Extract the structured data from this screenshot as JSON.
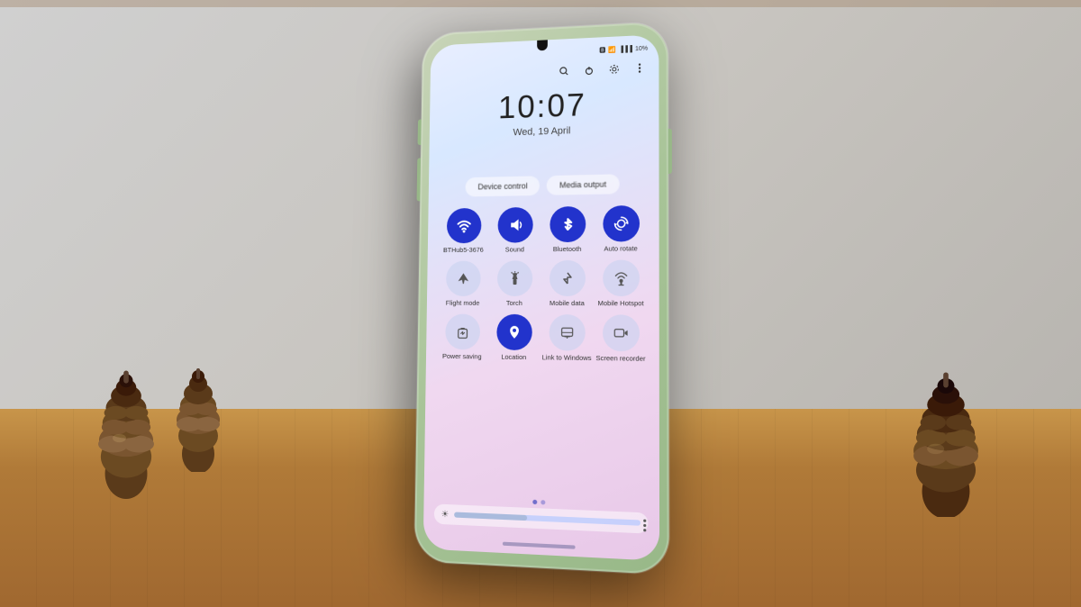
{
  "room": {
    "wall_color": "#c8c5c0",
    "table_color": "#c8954a"
  },
  "phone": {
    "frame_color": "#a8c498",
    "time": "10:07",
    "date": "Wed, 19 April",
    "status": {
      "battery": "10%",
      "signal": "4G"
    },
    "buttons": {
      "device_control": "Device control",
      "media_output": "Media output"
    },
    "quick_settings": {
      "row1": [
        {
          "id": "wifi",
          "label": "BTHub5-3676",
          "active": true,
          "icon": "📶"
        },
        {
          "id": "sound",
          "label": "Sound",
          "active": true,
          "icon": "🔊"
        },
        {
          "id": "bluetooth",
          "label": "Bluetooth",
          "active": true,
          "icon": "🔵"
        },
        {
          "id": "autorotate",
          "label": "Auto rotate",
          "active": true,
          "icon": "🔄"
        }
      ],
      "row2": [
        {
          "id": "flightmode",
          "label": "Flight mode",
          "active": false,
          "icon": "✈"
        },
        {
          "id": "torch",
          "label": "Torch",
          "active": false,
          "icon": "🔦"
        },
        {
          "id": "mobiledata",
          "label": "Mobile data",
          "active": false,
          "icon": "📡"
        },
        {
          "id": "mobilehotspot",
          "label": "Mobile Hotspot",
          "active": false,
          "icon": "📲"
        }
      ],
      "row3": [
        {
          "id": "powersaving",
          "label": "Power saving",
          "active": false,
          "icon": "🔋"
        },
        {
          "id": "location",
          "label": "Location",
          "active": true,
          "icon": "📍"
        },
        {
          "id": "linktowindows",
          "label": "Link to Windows",
          "active": false,
          "icon": "🪟"
        },
        {
          "id": "screenrecorder",
          "label": "Screen recorder",
          "active": false,
          "icon": "📹"
        }
      ]
    },
    "top_icons": {
      "search": "🔍",
      "power": "⏻",
      "settings": "⚙",
      "more": "⋮"
    }
  }
}
